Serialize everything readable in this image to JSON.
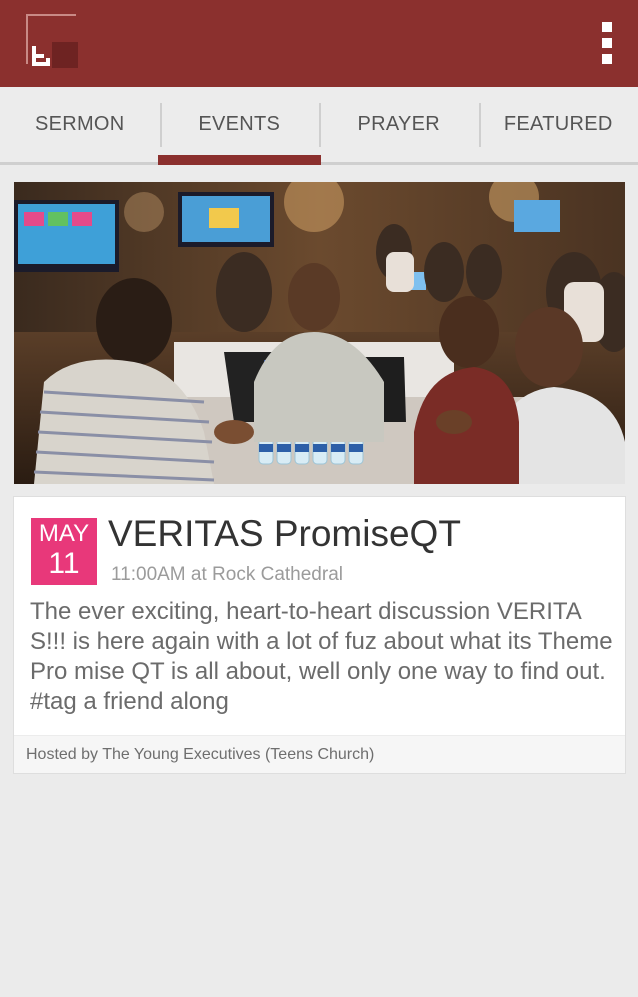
{
  "appbar": {
    "logo_icon": "app-logo",
    "menu_icon": "overflow-menu-icon",
    "background": "#8b302e"
  },
  "tabs": [
    {
      "label": "SERMON",
      "active": false
    },
    {
      "label": "EVENTS",
      "active": true
    },
    {
      "label": "PRAYER",
      "active": false
    },
    {
      "label": "FEATURED",
      "active": false
    }
  ],
  "event": {
    "image": "conference-photo",
    "date": {
      "month": "MAY",
      "day": "11"
    },
    "title": "VERITAS PromiseQT",
    "meta": "11:00AM at Rock Cathedral",
    "description": "The ever exciting, heart-to-heart discussion VERITAS!!! is here again with a lot of fuz about what its Theme Pro mise QT is all about, well only one way to find out. #tag a friend along",
    "host": "Hosted by The Young Executives (Teens Church)",
    "date_badge_color": "#e8387a"
  }
}
